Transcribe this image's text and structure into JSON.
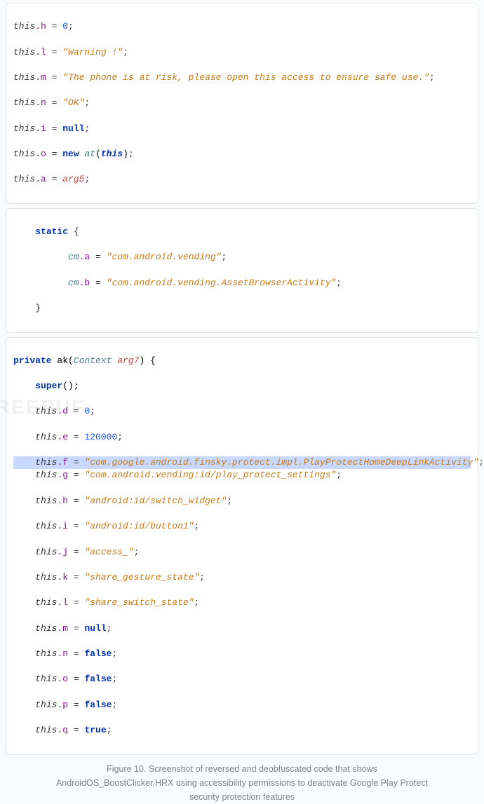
{
  "block1": {
    "l1_this": "this",
    "l1_mem": ".h",
    "l1_op": " = ",
    "l1_val": "0",
    "l1_semi": ";",
    "l2_this": "this",
    "l2_mem": ".l",
    "l2_op": " = ",
    "l2_str": "\"Warning !\"",
    "l2_semi": ";",
    "l3_this": "this",
    "l3_mem": ".m",
    "l3_op": " = ",
    "l3_str": "\"The phone is at risk, please open this access to ensure safe use.\"",
    "l3_semi": ";",
    "l4_this": "this",
    "l4_mem": ".n",
    "l4_op": " = ",
    "l4_str": "\"OK\"",
    "l4_semi": ";",
    "l5_this": "this",
    "l5_mem": ".i",
    "l5_op": " = ",
    "l5_kw": "null",
    "l5_semi": ";",
    "l6_this": "this",
    "l6_mem": ".o",
    "l6_op": " = ",
    "l6_kw": "new",
    "l6_sp": " ",
    "l6_cls": "at",
    "l6_open": "(",
    "l6_arg": "this",
    "l6_close": ")",
    "l6_semi": ";",
    "l7_this": "this",
    "l7_mem": ".a",
    "l7_op": " = ",
    "l7_arg": "arg5",
    "l7_semi": ";"
  },
  "block2": {
    "l1_indent": "    ",
    "l1_kw": "static",
    "l1_sp": " ",
    "l1_brace": "{",
    "l2_indent": "          ",
    "l2_cls": "cm",
    "l2_mem": ".a",
    "l2_op": " = ",
    "l2_str": "\"com.android.vending\"",
    "l2_semi": ";",
    "l3_indent": "          ",
    "l3_cls": "cm",
    "l3_mem": ".b",
    "l3_op": " = ",
    "l3_str": "\"com.android.vending.AssetBrowserActivity\"",
    "l3_semi": ";",
    "l4_indent": "    ",
    "l4_brace": "}"
  },
  "block3": {
    "l1_kw": "private",
    "l1_sp": " ",
    "l1_name": "ak(",
    "l1_cls": "Context",
    "l1_sp2": " ",
    "l1_arg": "arg7",
    "l1_close": ") {",
    "l2_indent": "    ",
    "l2_kw": "super",
    "l2_call": "();",
    "l3_indent": "    ",
    "l3_this": "this",
    "l3_mem": ".d",
    "l3_op": " = ",
    "l3_val": "0",
    "l3_semi": ";",
    "l4_indent": "    ",
    "l4_this": "this",
    "l4_mem": ".e",
    "l4_op": " = ",
    "l4_val": "120000",
    "l4_semi": ";",
    "l5_indent": "    ",
    "l5_this": "this",
    "l5_mem": ".f",
    "l5_op": " = ",
    "l5_str": "\"com.google.android.finsky.protect.impl.PlayProtectHomeDeepLinkActivity\"",
    "l5_semi": ";",
    "l6_indent": "    ",
    "l6_this": "this",
    "l6_mem": ".g",
    "l6_op": " = ",
    "l6_str": "\"com.android.vending:id/play_protect_settings\"",
    "l6_semi": ";",
    "l7_indent": "    ",
    "l7_this": "this",
    "l7_mem": ".h",
    "l7_op": " = ",
    "l7_str": "\"android:id/switch_widget\"",
    "l7_semi": ";",
    "l8_indent": "    ",
    "l8_this": "this",
    "l8_mem": ".i",
    "l8_op": " = ",
    "l8_str": "\"android:id/button1\"",
    "l8_semi": ";",
    "l9_indent": "    ",
    "l9_this": "this",
    "l9_mem": ".j",
    "l9_op": " = ",
    "l9_str": "\"access_\"",
    "l9_semi": ";",
    "l10_indent": "    ",
    "l10_this": "this",
    "l10_mem": ".k",
    "l10_op": " = ",
    "l10_str": "\"share_gesture_state\"",
    "l10_semi": ";",
    "l11_indent": "    ",
    "l11_this": "this",
    "l11_mem": ".l",
    "l11_op": " = ",
    "l11_str": "\"share_switch_state\"",
    "l11_semi": ";",
    "l12_indent": "    ",
    "l12_this": "this",
    "l12_mem": ".m",
    "l12_op": " = ",
    "l12_kw": "null",
    "l12_semi": ";",
    "l13_indent": "    ",
    "l13_this": "this",
    "l13_mem": ".n",
    "l13_op": " = ",
    "l13_kw": "false",
    "l13_semi": ";",
    "l14_indent": "    ",
    "l14_this": "this",
    "l14_mem": ".o",
    "l14_op": " = ",
    "l14_kw": "false",
    "l14_semi": ";",
    "l15_indent": "    ",
    "l15_this": "this",
    "l15_mem": ".p",
    "l15_op": " = ",
    "l15_kw": "false",
    "l15_semi": ";",
    "l16_indent": "    ",
    "l16_this": "this",
    "l16_mem": ".q",
    "l16_op": " = ",
    "l16_kw": "true",
    "l16_semi": ";"
  },
  "caption_line1": "Figure 10. Screenshot of reversed and deobfuscated code that shows",
  "caption_line2": "AndroidOS_BoostClicker.HRX using accessibility permissions to deactivate Google Play Protect",
  "caption_line3": "security protection features",
  "watermark": "REEBUF"
}
